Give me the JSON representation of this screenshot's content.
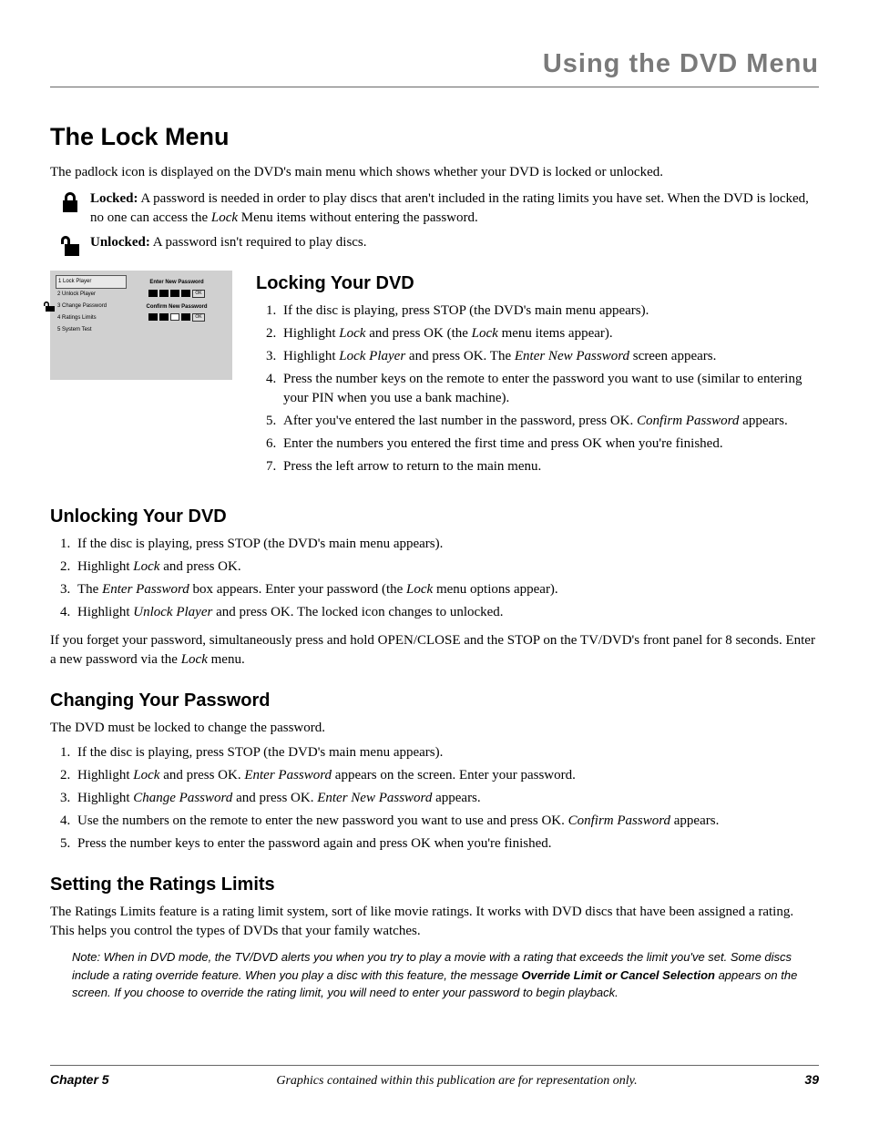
{
  "header": "Using the DVD Menu",
  "title": "The Lock Menu",
  "intro": "The padlock icon is displayed on the DVD's main menu which shows whether your DVD is locked or unlocked.",
  "states": {
    "locked": {
      "label": "Locked:",
      "before": " A password is needed in order to play discs that aren't included in the rating limits you have set. When the DVD is locked, no one can access the ",
      "ital": "Lock",
      "after": " Menu items without entering the password."
    },
    "unlocked": {
      "label": "Unlocked:",
      "text": "  A password isn't required to play discs."
    }
  },
  "menushot": {
    "items": [
      "1 Lock Player",
      "2 Unlock Player",
      "3 Change Password",
      "4 Ratings Limits",
      "5 System Test"
    ],
    "right1": "Enter New Password",
    "right2": "Confirm New Password",
    "ok": "OK"
  },
  "s1": {
    "title": "Locking Your DVD",
    "i1a": "If the disc is playing, press STOP (the DVD's main menu appears).",
    "i2a": "Highlight ",
    "i2b": "Lock",
    "i2c": " and press OK (the ",
    "i2d": "Lock",
    "i2e": " menu items appear).",
    "i3a": "Highlight ",
    "i3b": "Lock Player",
    "i3c": " and press OK. The ",
    "i3d": "Enter New Password",
    "i3e": " screen appears.",
    "i4a": "Press the number keys on the remote to enter the password you want to use (similar to entering your PIN when you use a bank machine).",
    "i5a": "After you've entered the last number in the password, press OK. ",
    "i5b": "Confirm Password",
    "i5c": " appears.",
    "i6a": "Enter the numbers you entered the first time and press OK when you're finished.",
    "i7a": "Press the left arrow to return to the main menu."
  },
  "s2": {
    "title": "Unlocking Your DVD",
    "i1": "If the disc is playing, press STOP (the DVD's main menu appears).",
    "i2a": "Highlight ",
    "i2b": "Lock",
    "i2c": " and press OK.",
    "i3a": "The ",
    "i3b": "Enter Password",
    "i3c": " box appears. Enter your password (the ",
    "i3d": "Lock",
    "i3e": " menu options appear).",
    "i4a": "Highlight ",
    "i4b": "Unlock Player",
    "i4c": " and press OK. The locked icon changes to unlocked.",
    "tail1": "If you forget your password, simultaneously press and hold OPEN/CLOSE and the STOP on the TV/DVD's front panel for 8 seconds. Enter a new password via the ",
    "tail2": "Lock",
    "tail3": " menu."
  },
  "s3": {
    "title": "Changing Your Password",
    "lead": "The DVD must be locked to change the password.",
    "i1": "If the disc is playing, press STOP (the DVD's main menu appears).",
    "i2a": "Highlight ",
    "i2b": "Lock",
    "i2c": " and press OK. ",
    "i2d": "Enter Password",
    "i2e": " appears on the screen. Enter your password.",
    "i3a": "Highlight ",
    "i3b": "Change Password",
    "i3c": " and press OK. ",
    "i3d": "Enter New Password",
    "i3e": " appears.",
    "i4a": "Use the numbers on the remote to enter the new password you want to use and press OK. ",
    "i4b": "Confirm Password",
    "i4c": " appears.",
    "i5": "Press the number keys to enter the password again and press OK when you're finished."
  },
  "s4": {
    "title": "Setting the Ratings Limits",
    "lead": "The Ratings Limits feature is a rating limit system, sort of like movie ratings. It works with DVD discs that have been assigned a rating. This helps you control the types of DVDs that your family watches.",
    "note1": "Note: When in DVD mode, the TV/DVD alerts you when you try to play a movie with a rating that exceeds the limit you've set. Some discs include a rating override feature. When you play a disc with this feature, the message ",
    "noteb": "Override Limit or Cancel Selection",
    "note2": " appears on the screen. If you choose to override the rating limit, you will need to enter your password to begin playback."
  },
  "footer": {
    "chapter": "Chapter 5",
    "mid": "Graphics contained within this publication are for representation only.",
    "page": "39"
  }
}
